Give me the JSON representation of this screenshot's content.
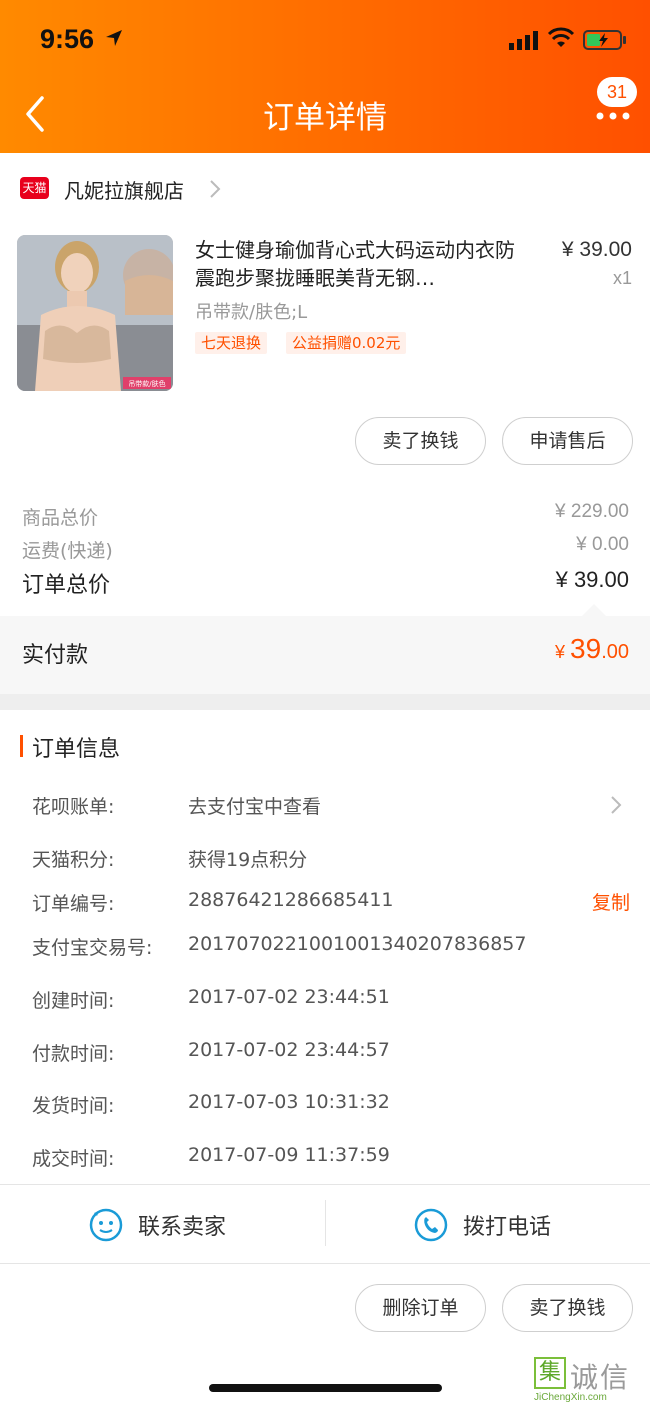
{
  "status_bar": {
    "time": "9:56"
  },
  "header": {
    "title": "订单详情",
    "badge_count": "31"
  },
  "shop": {
    "logo_text": "天猫",
    "name": "凡妮拉旗舰店"
  },
  "product": {
    "title": "女士健身瑜伽背心式大码运动内衣防震跑步聚拢睡眠美背无钢…",
    "price": "¥ 39.00",
    "quantity": "x1",
    "sku": "吊带款/肤色;L",
    "tags": [
      "七天退换",
      "公益捐赠0.02元"
    ],
    "image_caption": "吊带款/肤色"
  },
  "item_actions": {
    "sell_label": "卖了换钱",
    "after_sale_label": "申请售后"
  },
  "totals": {
    "goods_label": "商品总价",
    "goods_value": "¥ 229.00",
    "shipping_label": "运费(快递)",
    "shipping_value": "¥ 0.00",
    "order_label": "订单总价",
    "order_value": "¥ 39.00"
  },
  "paid": {
    "label": "实付款",
    "currency": "¥ ",
    "integer": "39",
    "decimal": ".00"
  },
  "order_info": {
    "title": "订单信息",
    "rows": [
      {
        "label": "花呗账单:",
        "value": "去支付宝中查看"
      },
      {
        "label": "天猫积分:",
        "value": "获得19点积分"
      },
      {
        "label": "订单编号:",
        "value": "2887642128668541​1"
      },
      {
        "label": "支付宝交易号:",
        "value": "2017070221001001340207836857"
      },
      {
        "label": "创建时间:",
        "value": "2017-07-02 23:44:51"
      },
      {
        "label": "付款时间:",
        "value": "2017-07-02 23:44:57"
      },
      {
        "label": "发货时间:",
        "value": "2017-07-03 10:31:32"
      },
      {
        "label": "成交时间:",
        "value": "2017-07-09 11:37:59"
      }
    ],
    "copy_label": "复制"
  },
  "contact": {
    "seller_label": "联系卖家",
    "call_label": "拨打电话"
  },
  "bottom_actions": {
    "delete_label": "删除订单",
    "sell_label": "卖了换钱"
  },
  "watermark": {
    "mark": "集",
    "name": "诚信",
    "url": "JiChengXin.com"
  },
  "colors": {
    "accent": "#ff5000",
    "header_start": "#ff8a00",
    "contact_icon": "#1a9bd7"
  }
}
